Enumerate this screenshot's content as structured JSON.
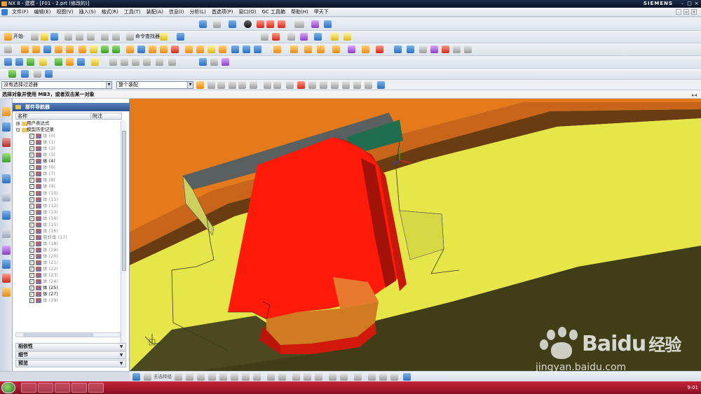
{
  "window": {
    "title": "NX 8 - 建模 - [F01 - 2.prt (修改的)]",
    "brand": "SIEMENS"
  },
  "menu": {
    "items": [
      "文件(F)",
      "编辑(E)",
      "视图(V)",
      "插入(S)",
      "格式(R)",
      "工具(T)",
      "装配(A)",
      "信息(I)",
      "分析(L)",
      "首选项(P)",
      "窗口(O)",
      "GC 工具箱",
      "帮助(H)",
      "甲天下"
    ]
  },
  "toolbar": {
    "start_label": "开始·",
    "command_finder_label": "命令查找器"
  },
  "selection": {
    "filter": "没有选择过滤器",
    "scope": "整个装配"
  },
  "cue": {
    "text": "选择对象并使用 MB3，或者双击某一对象"
  },
  "navigator": {
    "title": "部件导航器",
    "col_name": "名称",
    "col_note": "附注",
    "root_items": [
      {
        "label": "用户表达式",
        "expanded": false
      },
      {
        "label": "模型历史记录",
        "expanded": true
      }
    ],
    "features": [
      {
        "label": "体 (0)",
        "dim": true
      },
      {
        "label": "体 (1)",
        "dim": true
      },
      {
        "label": "体 (2)",
        "dim": true
      },
      {
        "label": "体 (3)",
        "dim": true
      },
      {
        "label": "体 (4)",
        "dim": false
      },
      {
        "label": "体 (6)",
        "dim": true
      },
      {
        "label": "体 (7)",
        "dim": true
      },
      {
        "label": "体 (8)",
        "dim": true
      },
      {
        "label": "体 (9)",
        "dim": true
      },
      {
        "label": "体 (10)",
        "dim": true
      },
      {
        "label": "体 (11)",
        "dim": true
      },
      {
        "label": "体 (12)",
        "dim": true
      },
      {
        "label": "体 (13)",
        "dim": true
      },
      {
        "label": "体 (14)",
        "dim": true
      },
      {
        "label": "体 (15)",
        "dim": true
      },
      {
        "label": "体 (16)",
        "dim": true
      },
      {
        "label": "倒斜角 (17)",
        "dim": true
      },
      {
        "label": "体 (18)",
        "dim": true
      },
      {
        "label": "体 (19)",
        "dim": true
      },
      {
        "label": "体 (20)",
        "dim": true
      },
      {
        "label": "体 (21)",
        "dim": true
      },
      {
        "label": "体 (22)",
        "dim": true
      },
      {
        "label": "体 (23)",
        "dim": true
      },
      {
        "label": "体 (24)",
        "dim": true
      },
      {
        "label": "体 (25)",
        "dim": false
      },
      {
        "label": "体 (27)",
        "dim": false
      },
      {
        "label": "体 (29)",
        "dim": true
      }
    ],
    "sections": [
      "相依性",
      "细节",
      "预览"
    ]
  },
  "bottom_toolbar": {
    "label": "无选择组"
  },
  "taskbar": {
    "clock": "9:01"
  },
  "watermark": {
    "brand_text": "Bai",
    "brand_text2": "du",
    "brand_cn": "经验",
    "url": "jingyan.baidu.com"
  },
  "colors": {
    "red_part": "#ff1a0a",
    "yellow_surface": "#e8e84a",
    "orange_surface": "#e4791c",
    "dark_olive": "#3e3d1a",
    "teal": "#2a8a60",
    "title_bar": "#1c2c4a",
    "taskbar": "#b01830"
  }
}
